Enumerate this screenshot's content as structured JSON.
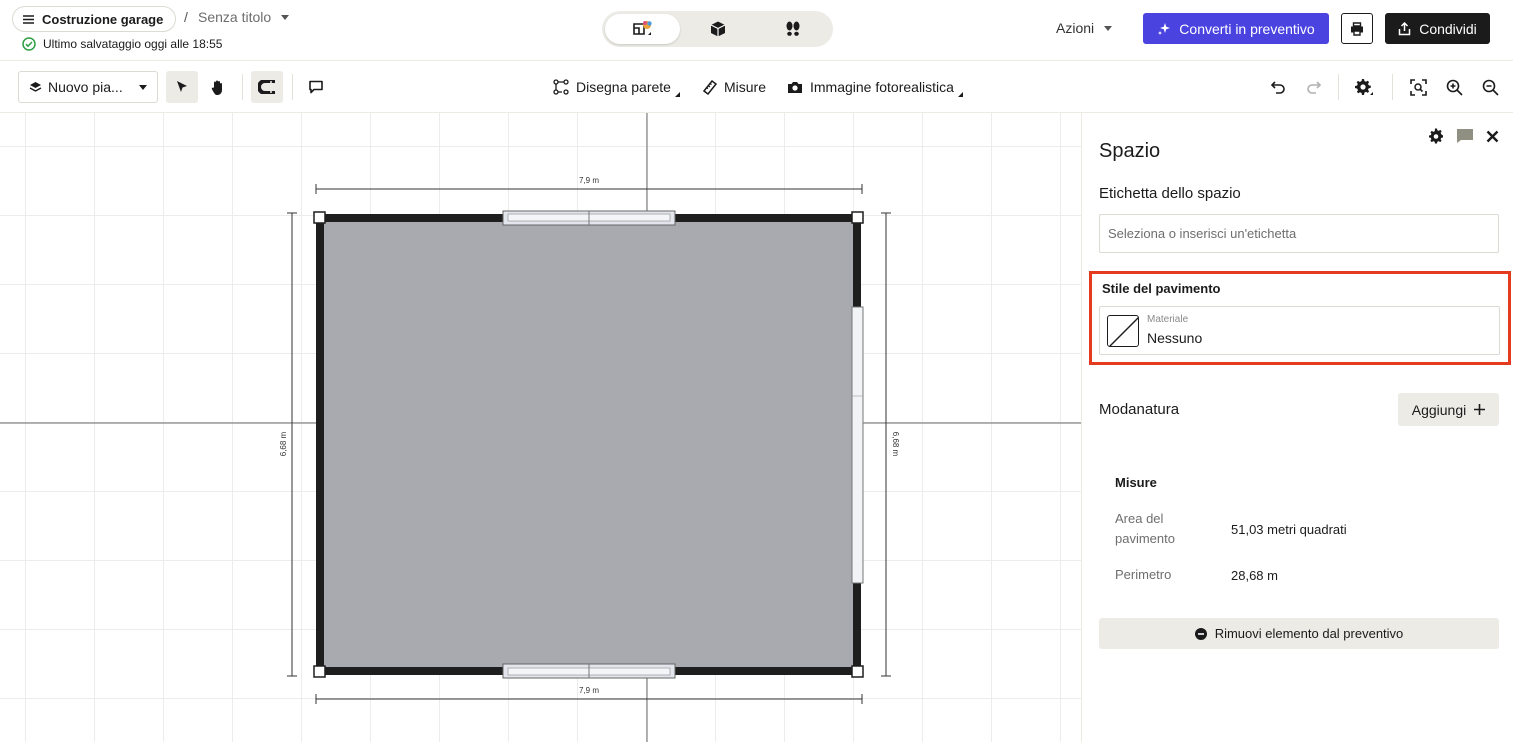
{
  "header": {
    "project_name": "Costruzione garage",
    "breadcrumb_sep": "/",
    "doc_title": "Senza titolo",
    "save_status": "Ultimo salvataggio oggi alle 18:55",
    "view_modes": [
      "2d-plan-icon",
      "3d-box-icon",
      "walkthrough-footprints-icon"
    ],
    "actions_label": "Azioni",
    "convert_label": "Converti in preventivo",
    "share_label": "Condividi",
    "accent_color": "#4a43e0"
  },
  "toolbar": {
    "level_label": "Nuovo pia...",
    "draw_wall": "Disegna parete",
    "measures": "Misure",
    "photo_image": "Immagine fotorealistica"
  },
  "canvas": {
    "dim_top": "7,9 m",
    "dim_bottom": "7,9 m",
    "dim_left": "6,68 m",
    "dim_right": "6,68 m",
    "room_fill": "#a8aab0"
  },
  "panel": {
    "title": "Spazio",
    "space_label_heading": "Etichetta dello spazio",
    "space_label_placeholder": "Seleziona o inserisci un'etichetta",
    "floor_style_heading": "Stile del pavimento",
    "material_caption": "Materiale",
    "material_value": "Nessuno",
    "highlight_color": "#e43a1e",
    "molding_heading": "Modanatura",
    "add_label": "Aggiungi",
    "measures_heading": "Misure",
    "area_label": "Area del pavimento",
    "area_value": "51,03 metri quadrati",
    "perimeter_label": "Perimetro",
    "perimeter_value": "28,68 m",
    "remove_label": "Rimuovi elemento dal preventivo"
  }
}
